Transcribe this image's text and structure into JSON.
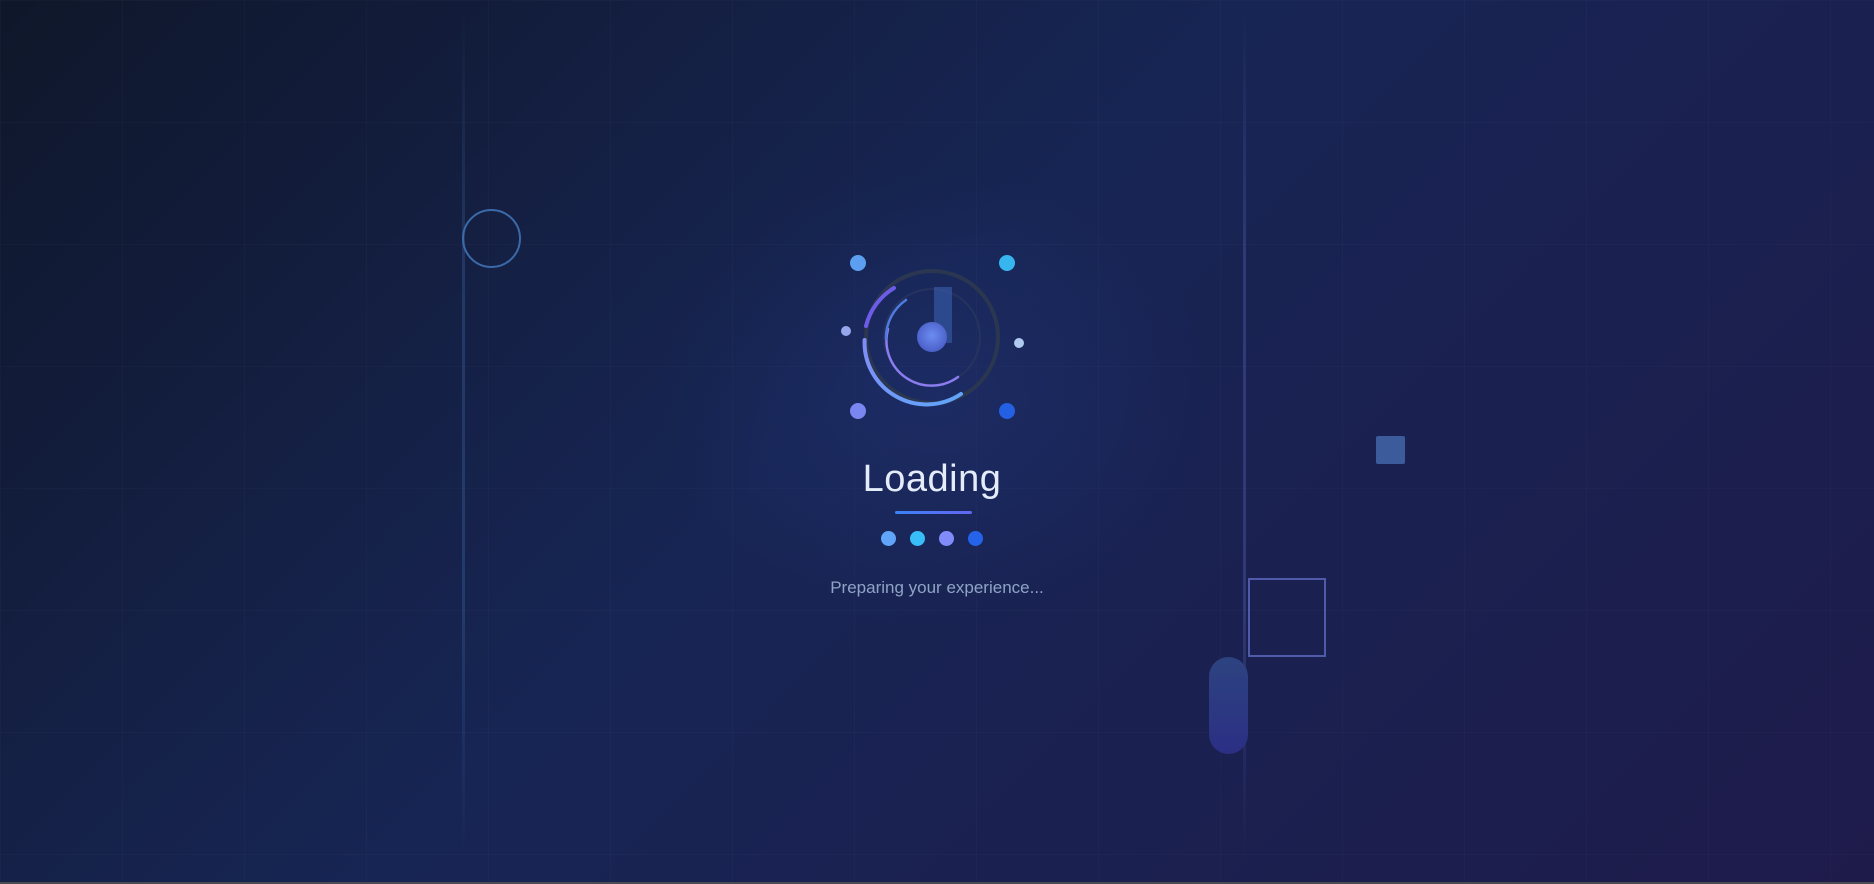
{
  "loader": {
    "title": "Loading",
    "subtitle": "Preparing your experience...",
    "colors": {
      "accent_blue": "#60a5fa",
      "accent_cyan": "#38bdf8",
      "accent_violet": "#818cf8",
      "accent_royal": "#2563eb",
      "background_start": "#0f172a",
      "background_end": "#1e1b4b"
    },
    "progress_dots": [
      {
        "color": "#60a5fa"
      },
      {
        "color": "#38bdf8"
      },
      {
        "color": "#818cf8"
      },
      {
        "color": "#2563eb"
      }
    ]
  }
}
